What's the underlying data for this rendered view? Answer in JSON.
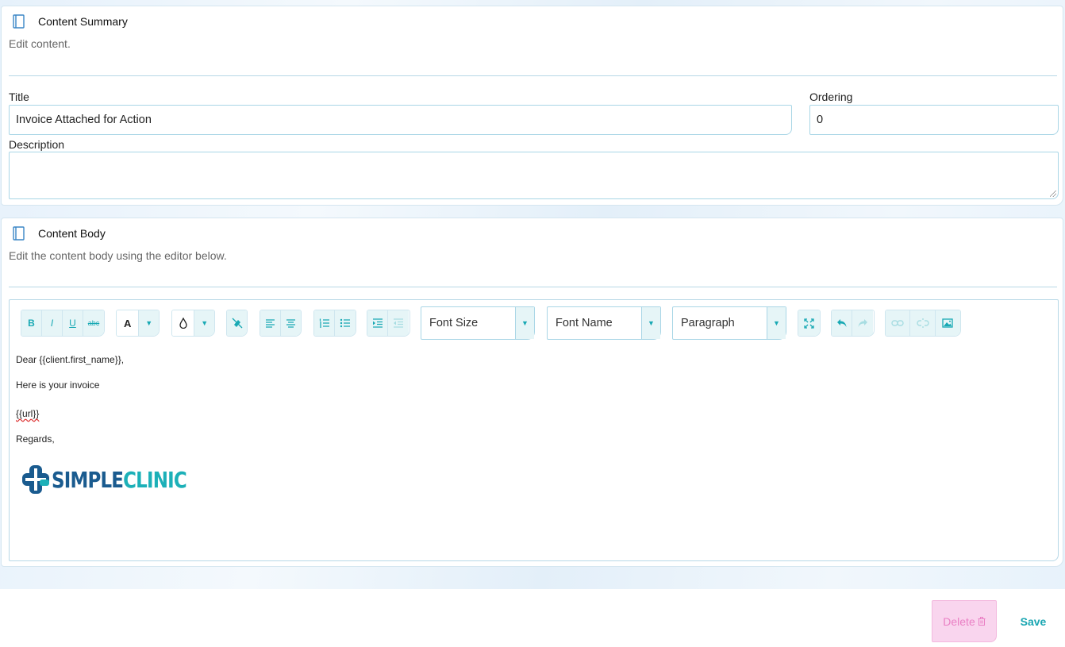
{
  "summary": {
    "title": "Content Summary",
    "subtitle": "Edit content.",
    "title_label": "Title",
    "title_value": "Invoice Attached for Action",
    "ordering_label": "Ordering",
    "ordering_value": "0",
    "description_label": "Description",
    "description_value": ""
  },
  "body": {
    "title": "Content Body",
    "subtitle": "Edit the content body using the editor below."
  },
  "toolbar": {
    "bold": "B",
    "italic": "I",
    "underline": "U",
    "strike": "abc",
    "font_color": "A",
    "font_size": "Font Size",
    "font_name": "Font Name",
    "paragraph": "Paragraph"
  },
  "editor": {
    "line1": "Dear {{client.first_name}},",
    "line2": "Here is your invoice",
    "line3": "{{url}}",
    "line4": "Regards,",
    "logo_part1": "SIMPLE",
    "logo_part2": "CLINIC"
  },
  "actions": {
    "delete": "Delete",
    "save": "Save"
  },
  "colors": {
    "accent": "#19a9b4",
    "border": "#a9d6e6",
    "delete_bg": "#f9d5ee",
    "delete_text": "#ea7fc4",
    "logo_blue": "#1a5b8f",
    "logo_teal": "#1cb0b8"
  },
  "icons": {
    "section": "book-icon",
    "clear_format": "eraser-icon",
    "align_left": "align-left-icon",
    "align_center": "align-center-icon",
    "ordered_list": "ordered-list-icon",
    "unordered_list": "unordered-list-icon",
    "indent": "indent-icon",
    "outdent": "outdent-icon",
    "fullscreen": "fullscreen-icon",
    "undo": "undo-icon",
    "redo": "redo-icon",
    "link": "link-icon",
    "unlink": "unlink-icon",
    "image": "image-icon",
    "trash": "trash-icon"
  }
}
